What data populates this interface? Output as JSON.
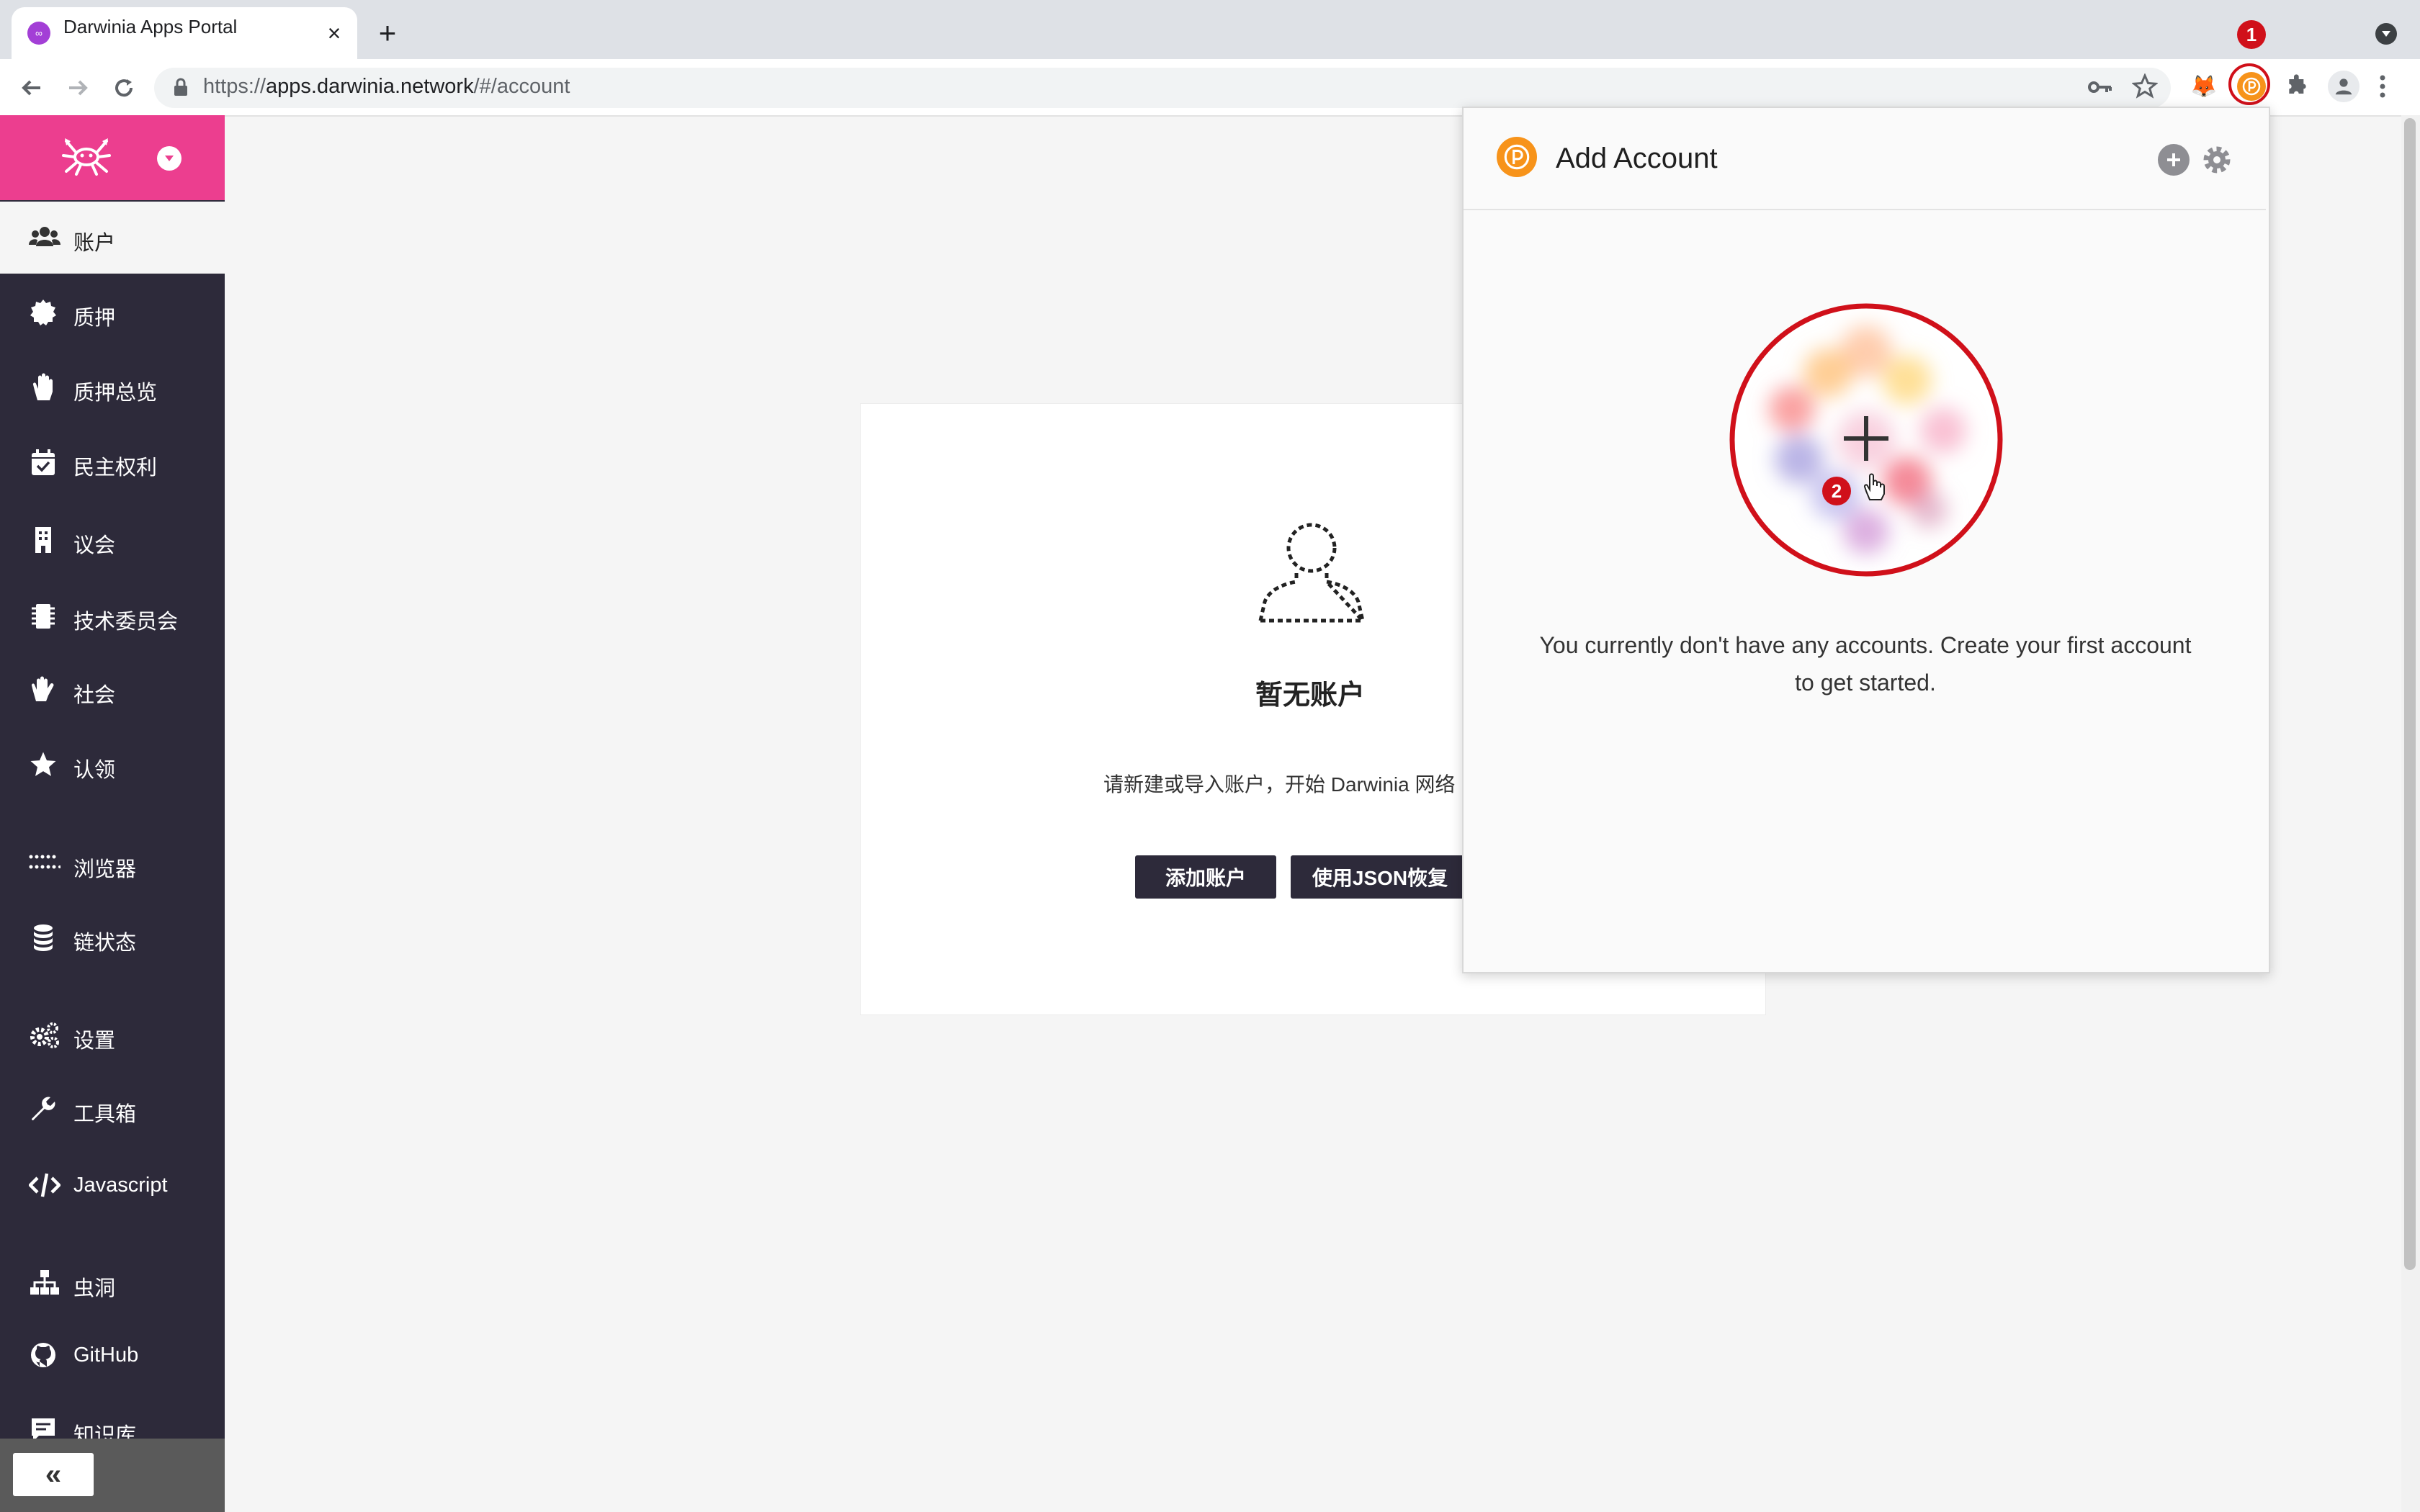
{
  "browser": {
    "tab_title": "Darwinia Apps Portal",
    "url_prefix": "https://",
    "url_host": "apps.darwinia.network",
    "url_path": "/#/account"
  },
  "sidebar": {
    "items": [
      {
        "label": "账户",
        "icon": "users-icon",
        "active": true
      },
      {
        "label": "质押",
        "icon": "badge-icon"
      },
      {
        "label": "质押总览",
        "icon": "hand-icon"
      },
      {
        "label": "民主权利",
        "icon": "calendar-check-icon"
      },
      {
        "label": "议会",
        "icon": "building-icon"
      },
      {
        "label": "技术委员会",
        "icon": "microchip-icon"
      },
      {
        "label": "社会",
        "icon": "handshake-icon"
      },
      {
        "label": "认领",
        "icon": "star-icon"
      },
      {
        "label": "浏览器",
        "icon": "dots-grid-icon"
      },
      {
        "label": "链状态",
        "icon": "database-icon"
      },
      {
        "label": "设置",
        "icon": "cogs-icon"
      },
      {
        "label": "工具箱",
        "icon": "wrench-icon"
      },
      {
        "label": "Javascript",
        "icon": "code-icon"
      },
      {
        "label": "虫洞",
        "icon": "sitemap-icon"
      },
      {
        "label": "GitHub",
        "icon": "github-icon"
      },
      {
        "label": "知识库",
        "icon": "comment-icon"
      }
    ],
    "collapse_label": "«"
  },
  "main": {
    "empty_title": "暂无账户",
    "empty_desc": "请新建或导入账户，开始 Darwinia 网络",
    "add_account_button": "添加账户",
    "restore_json_button": "使用JSON恢复"
  },
  "popup": {
    "title": "Add Account",
    "message": "You currently don't have any accounts. Create your first account to get started."
  },
  "annotations": {
    "step1": "1",
    "step2": "2"
  },
  "colors": {
    "brand_pink": "#ec3e8f",
    "sidebar_bg": "#2d2a3a",
    "polkadot_orange": "#f7931a",
    "annotation_red": "#d0101a"
  }
}
